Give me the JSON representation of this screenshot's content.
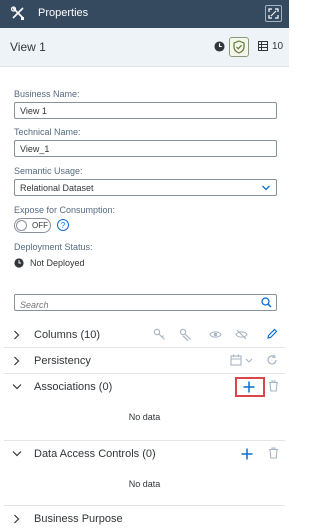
{
  "header": {
    "title": "Properties",
    "tool_icon": "tools-icon",
    "expand_icon": "expand-icon"
  },
  "view": {
    "title": "View 1",
    "object_count": "10"
  },
  "form": {
    "business_name": {
      "label": "Business Name:",
      "value": "View 1"
    },
    "technical_name": {
      "label": "Technical Name:",
      "value": "View_1"
    },
    "semantic_usage": {
      "label": "Semantic Usage:",
      "value": "Relational Dataset"
    },
    "expose": {
      "label": "Expose for Consumption:",
      "toggle": "OFF",
      "help": "?"
    },
    "deployment": {
      "label": "Deployment Status:",
      "value": "Not Deployed"
    }
  },
  "search": {
    "placeholder": "Search"
  },
  "sections": {
    "columns": {
      "title": "Columns (10)"
    },
    "persistency": {
      "title": "Persistency"
    },
    "associations": {
      "title": "Associations (0)",
      "empty": "No data"
    },
    "dac": {
      "title": "Data Access Controls (0)",
      "empty": "No data"
    },
    "business_purpose": {
      "title": "Business Purpose"
    }
  },
  "colors": {
    "header_bg": "#354a5f",
    "accent": "#0a6ed1",
    "highlight": "#d9474b"
  }
}
